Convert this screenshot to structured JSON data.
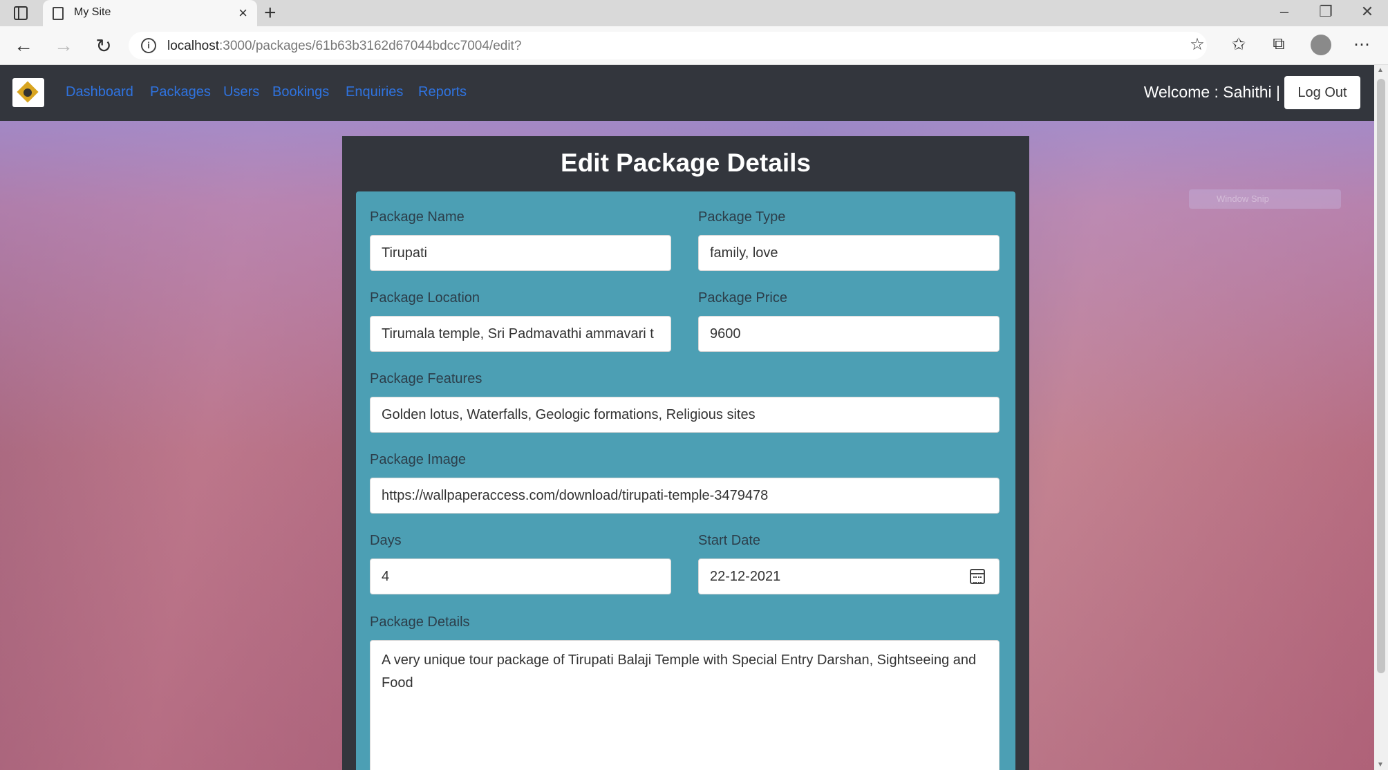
{
  "browser": {
    "tab_title": "My Site",
    "new_tab_symbol": "+",
    "url_host": "localhost",
    "url_path": ":3000/packages/61b63b3162d67044bdcc7004/edit?"
  },
  "nav": {
    "links": [
      "Dashboard",
      "Packages",
      "Users",
      "Bookings",
      "Enquiries",
      "Reports"
    ],
    "welcome": "Welcome : Sahithi |",
    "logout_label": "Log Out"
  },
  "snip_overlay": "Window Snip",
  "form": {
    "title": "Edit Package Details",
    "package_name": {
      "label": "Package Name",
      "value": "Tirupati"
    },
    "package_type": {
      "label": "Package Type",
      "value": "family, love"
    },
    "package_location": {
      "label": "Package Location",
      "value": "Tirumala temple, Sri Padmavathi ammavari t"
    },
    "package_price": {
      "label": "Package Price",
      "value": "9600"
    },
    "package_features": {
      "label": "Package Features",
      "value": "Golden lotus, Waterfalls, Geologic formations, Religious sites"
    },
    "package_image": {
      "label": "Package Image",
      "value": "https://wallpaperaccess.com/download/tirupati-temple-3479478"
    },
    "days": {
      "label": "Days",
      "value": "4"
    },
    "start_date": {
      "label": "Start Date",
      "value": "22-12-2021"
    },
    "package_details": {
      "label": "Package Details",
      "value": "A very unique tour package of Tirupati Balaji Temple with Special Entry Darshan, Sightseeing and Food"
    }
  }
}
